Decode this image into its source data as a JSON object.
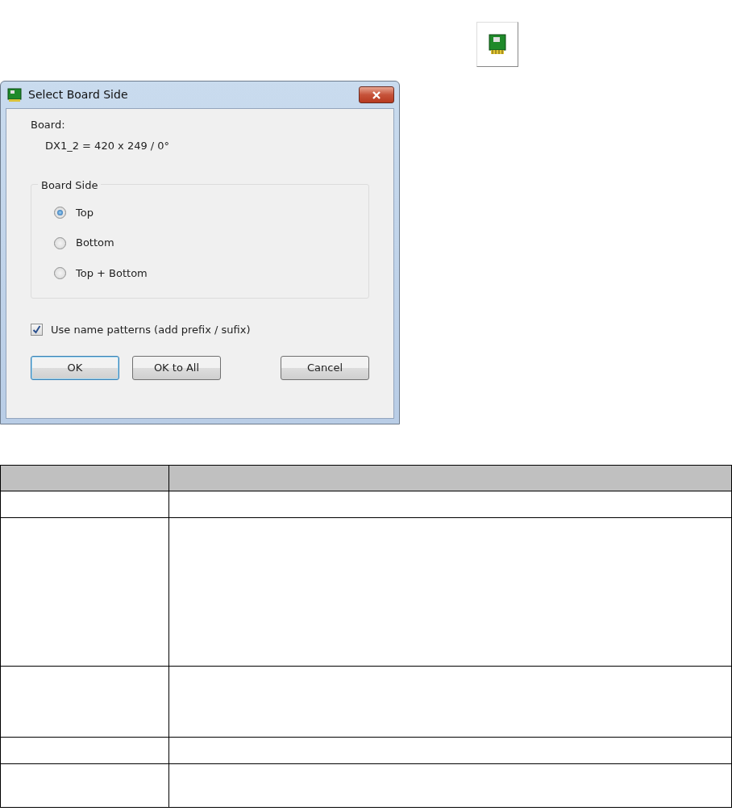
{
  "dialog": {
    "title": "Select Board Side",
    "board_label": "Board:",
    "board_value": "DX1_2 = 420 x 249 / 0°",
    "group": {
      "title": "Board Side",
      "options": [
        {
          "label": "Top",
          "selected": true
        },
        {
          "label": "Bottom",
          "selected": false
        },
        {
          "label": "Top + Bottom",
          "selected": false
        }
      ]
    },
    "checkbox": {
      "label": "Use name patterns (add prefix / sufix)",
      "checked": true
    },
    "buttons": [
      {
        "label": "OK",
        "default": true
      },
      {
        "label": "OK to All",
        "default": false
      },
      {
        "label": "Cancel",
        "default": false
      }
    ]
  }
}
